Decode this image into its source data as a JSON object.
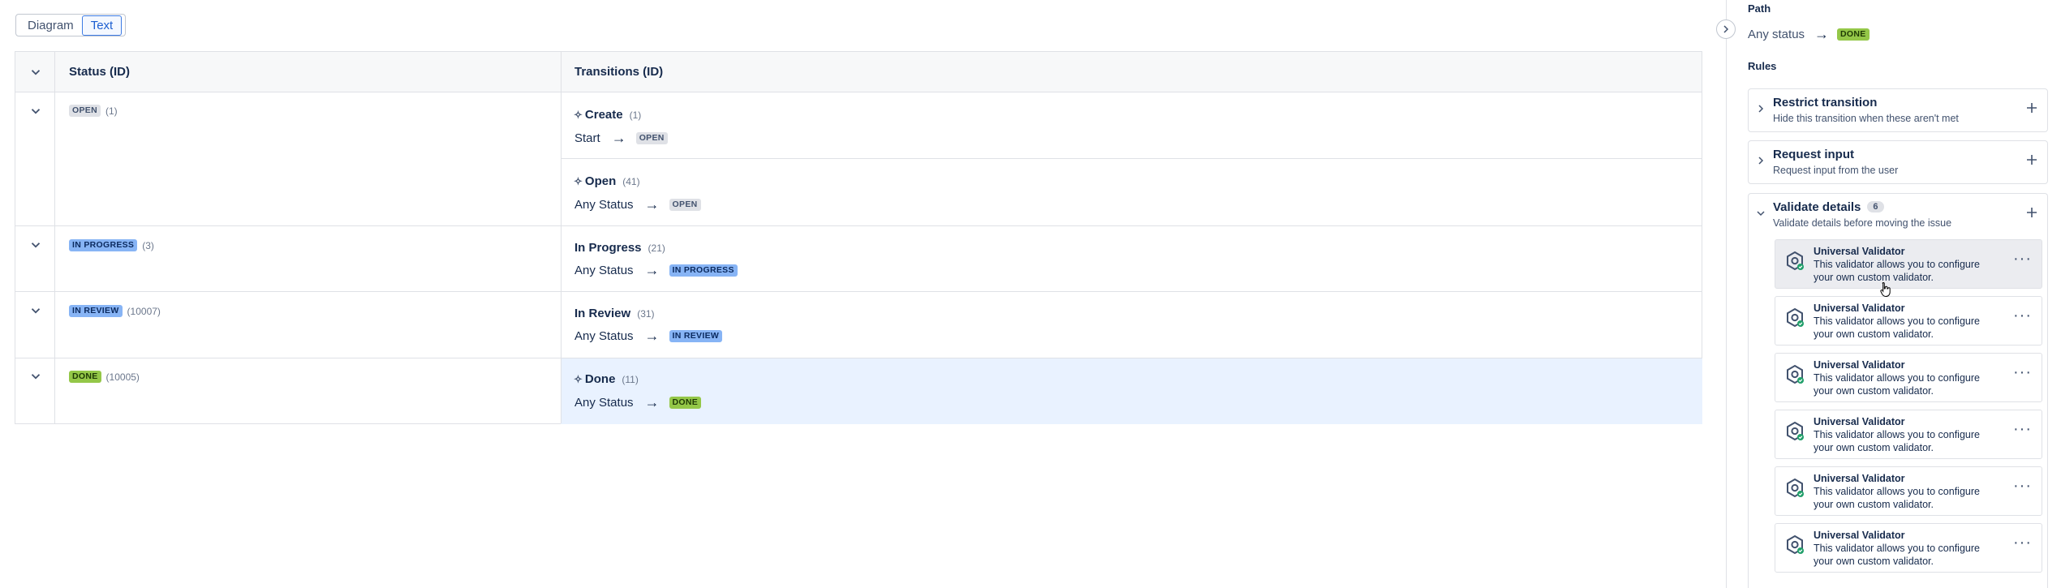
{
  "view_toggle": {
    "diagram": "Diagram",
    "text": "Text"
  },
  "table": {
    "col_status": "Status (ID)",
    "col_transitions": "Transitions (ID)",
    "rows": [
      {
        "status": "OPEN",
        "status_id": "(1)",
        "transitions": [
          {
            "name": "Create",
            "id": "(1)",
            "from": "Start",
            "to": "OPEN"
          },
          {
            "name": "Open",
            "id": "(41)",
            "from": "Any Status",
            "to": "OPEN"
          }
        ]
      },
      {
        "status": "IN PROGRESS",
        "status_id": "(3)",
        "transitions": [
          {
            "name": "In Progress",
            "id": "(21)",
            "from": "Any Status",
            "to": "IN PROGRESS"
          }
        ]
      },
      {
        "status": "IN REVIEW",
        "status_id": "(10007)",
        "transitions": [
          {
            "name": "In Review",
            "id": "(31)",
            "from": "Any Status",
            "to": "IN REVIEW"
          }
        ]
      },
      {
        "status": "DONE",
        "status_id": "(10005)",
        "transitions": [
          {
            "name": "Done",
            "id": "(11)",
            "from": "Any Status",
            "to": "DONE"
          }
        ]
      }
    ]
  },
  "panel": {
    "path_label": "Path",
    "path_from": "Any status",
    "path_to": "DONE",
    "rules_label": "Rules",
    "rules": [
      {
        "title": "Restrict transition",
        "desc": "Hide this transition when these aren't met"
      },
      {
        "title": "Request input",
        "desc": "Request input from the user"
      },
      {
        "title": "Validate details",
        "desc": "Validate details before moving the issue",
        "count": "6"
      }
    ],
    "validators": [
      {
        "title": "Universal Validator",
        "desc": "This validator allows you to configure your own custom validator."
      },
      {
        "title": "Universal Validator",
        "desc": "This validator allows you to configure your own custom validator."
      },
      {
        "title": "Universal Validator",
        "desc": "This validator allows you to configure your own custom validator."
      },
      {
        "title": "Universal Validator",
        "desc": "This validator allows you to configure your own custom validator."
      },
      {
        "title": "Universal Validator",
        "desc": "This validator allows you to configure your own custom validator."
      },
      {
        "title": "Universal Validator",
        "desc": "This validator allows you to configure your own custom validator."
      }
    ]
  },
  "colors": {
    "accent": "#3d7be4",
    "done_lozenge": "#94c748",
    "progress_lozenge": "#87b4f5",
    "selected_row": "#e9f2ff"
  }
}
